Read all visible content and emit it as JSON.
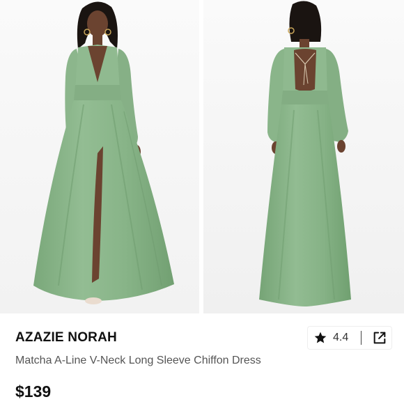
{
  "product": {
    "brand": "AZAZIE NORAH",
    "name": "Matcha A-Line V-Neck Long Sleeve Chiffon Dress",
    "price": "$139",
    "rating": "4.4"
  },
  "images": [
    {
      "view": "front",
      "alt": "Model wearing matcha green V-neck long sleeve chiffon dress, front view"
    },
    {
      "view": "back",
      "alt": "Model wearing matcha green dress with open back, back view"
    }
  ],
  "icons": {
    "rating": "star-icon",
    "share": "share-external-icon"
  },
  "colors": {
    "dress": "#8fb88f",
    "dress_shadow": "#78a378",
    "text_primary": "#111111",
    "text_secondary": "#555555"
  }
}
